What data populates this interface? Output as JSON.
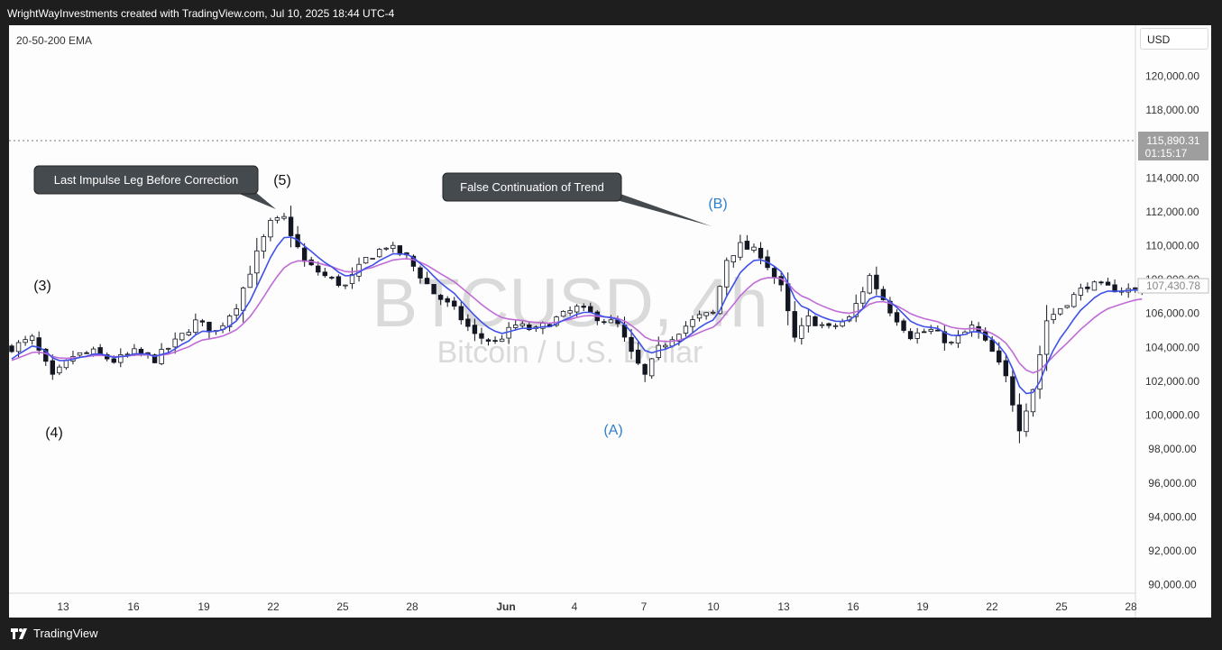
{
  "header": {
    "attribution": "WrightWayInvestments created with TradingView.com, Jul 10, 2025 18:44 UTC-4"
  },
  "indicator": {
    "label": "20-50-200 EMA"
  },
  "currency_button": {
    "label": "USD"
  },
  "watermark": {
    "symbol": "BTCUSD, 4h",
    "name": "Bitcoin / U.S. Dollar"
  },
  "footer": {
    "brand": "TradingView"
  },
  "colors": {
    "up_candle": "#ffffff",
    "down_candle": "#131722",
    "ema_fast": "#3f51e8",
    "ema_slow": "#c06bd6",
    "callout_bg": "#454a4f",
    "wave_blue": "#2f7fc9",
    "price_tag_bg": "#9e9e9e"
  },
  "chart_data": {
    "type": "candlestick",
    "title": "BTCUSD, 4h",
    "ylim": [
      89500,
      123000
    ],
    "y_ticks": [
      "90,000.00",
      "92,000.00",
      "94,000.00",
      "96,000.00",
      "98,000.00",
      "100,000.00",
      "102,000.00",
      "104,000.00",
      "106,000.00",
      "108,000.00",
      "110,000.00",
      "112,000.00",
      "114,000.00",
      "116,000.00",
      "118,000.00",
      "120,000.00"
    ],
    "x_ticks": [
      "13",
      "16",
      "19",
      "22",
      "25",
      "28",
      "Jun",
      "4",
      "7",
      "10",
      "13",
      "16",
      "19",
      "22",
      "25",
      "28"
    ],
    "price_line": {
      "value": 115890.31,
      "label": "115,890.31",
      "timer": "01:15:17"
    },
    "last_price": {
      "value": 107430.78,
      "label": "107,430.78"
    },
    "path_knots": [
      [
        0,
        104000
      ],
      [
        3,
        104500
      ],
      [
        6,
        102200
      ],
      [
        9,
        103500
      ],
      [
        12,
        103700
      ],
      [
        15,
        103200
      ],
      [
        18,
        103700
      ],
      [
        21,
        103300
      ],
      [
        24,
        104300
      ],
      [
        27,
        105500
      ],
      [
        30,
        104900
      ],
      [
        33,
        106500
      ],
      [
        36,
        109500
      ],
      [
        38,
        111300
      ],
      [
        40,
        111600
      ],
      [
        43,
        109000
      ],
      [
        46,
        108200
      ],
      [
        49,
        107600
      ],
      [
        52,
        109200
      ],
      [
        55,
        110000
      ],
      [
        58,
        109300
      ],
      [
        62,
        107200
      ],
      [
        65,
        106200
      ],
      [
        68,
        104700
      ],
      [
        71,
        104300
      ],
      [
        74,
        105300
      ],
      [
        77,
        105000
      ],
      [
        80,
        105700
      ],
      [
        83,
        106300
      ],
      [
        86,
        105800
      ],
      [
        89,
        105300
      ],
      [
        91,
        103600
      ],
      [
        93,
        102300
      ],
      [
        95,
        103900
      ],
      [
        98,
        105000
      ],
      [
        101,
        105800
      ],
      [
        103,
        106000
      ],
      [
        105,
        109200
      ],
      [
        107,
        110000
      ],
      [
        110,
        109500
      ],
      [
        113,
        107500
      ],
      [
        115,
        104500
      ],
      [
        117,
        105700
      ],
      [
        120,
        105100
      ],
      [
        123,
        105700
      ],
      [
        126,
        108200
      ],
      [
        129,
        106200
      ],
      [
        132,
        104700
      ],
      [
        135,
        105000
      ],
      [
        138,
        104200
      ],
      [
        141,
        105200
      ],
      [
        142,
        104800
      ],
      [
        144,
        103700
      ],
      [
        146,
        102200
      ],
      [
        148,
        99300
      ],
      [
        150,
        101600
      ],
      [
        152,
        105600
      ],
      [
        155,
        106700
      ],
      [
        158,
        107700
      ],
      [
        161,
        107500
      ],
      [
        164,
        107400
      ],
      [
        166,
        107400
      ]
    ],
    "series": [
      {
        "name": "20 EMA"
      },
      {
        "name": "50 EMA"
      }
    ],
    "annotations": [
      {
        "text": "Last Impulse Leg Before Correction",
        "kind": "callout"
      },
      {
        "text": "False Continuation of Trend",
        "kind": "callout"
      },
      {
        "text": "(3)",
        "kind": "wave",
        "color": "#111111",
        "value": 108000
      },
      {
        "text": "(4)",
        "kind": "wave",
        "color": "#111111",
        "value": 99300
      },
      {
        "text": "(5)",
        "kind": "wave",
        "color": "#111111",
        "value": 112900
      },
      {
        "text": "(A)",
        "kind": "wave",
        "color": "#2f7fc9",
        "value": 99300
      },
      {
        "text": "(B)",
        "kind": "wave",
        "color": "#2f7fc9",
        "value": 112100
      }
    ]
  }
}
